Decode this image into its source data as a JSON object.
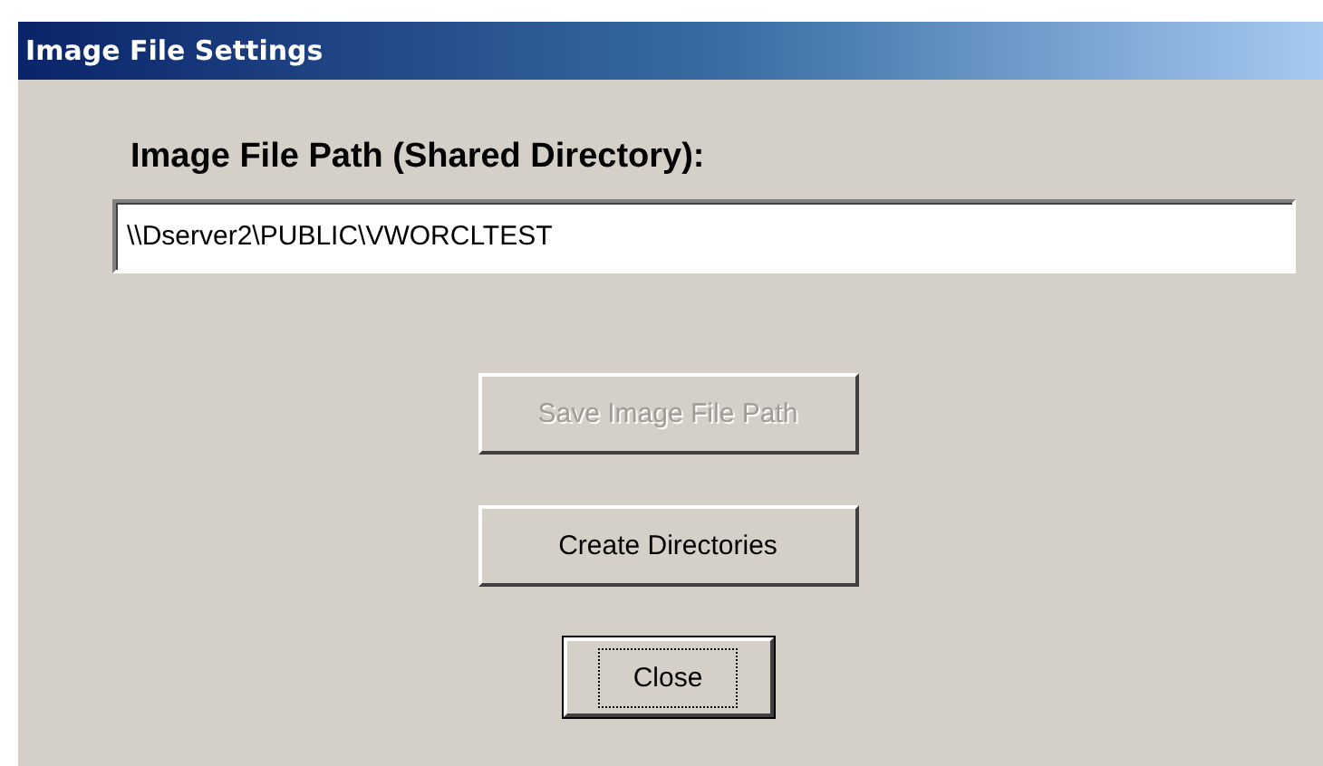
{
  "window": {
    "title": "Image File Settings"
  },
  "path_label": "Image File Path (Shared Directory):",
  "path_field": {
    "value": "\\\\Dserver2\\PUBLIC\\VWORCLTEST"
  },
  "buttons": [
    {
      "label": "Save Image File Path",
      "disabled": true,
      "focused": false,
      "kind": "wide"
    },
    {
      "label": "Create Directories",
      "disabled": false,
      "focused": false,
      "kind": "wide"
    },
    {
      "label": "Close",
      "disabled": false,
      "focused": true,
      "kind": "small"
    }
  ]
}
